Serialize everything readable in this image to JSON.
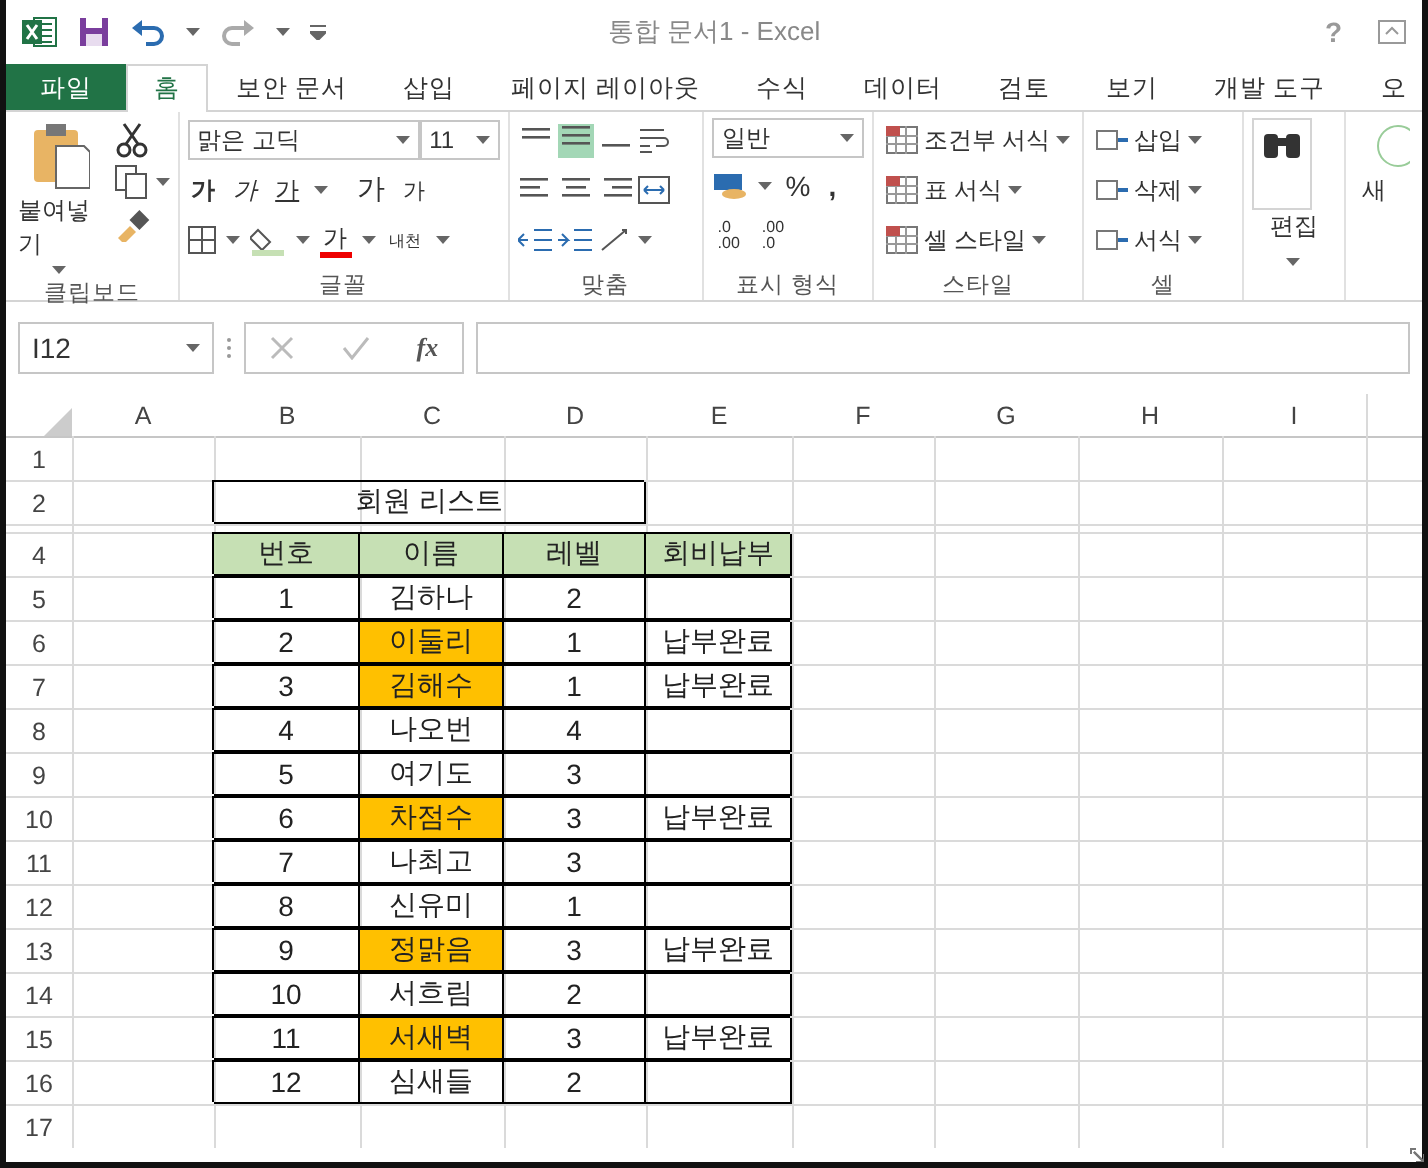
{
  "window": {
    "title": "통합 문서1 - Excel",
    "help": "?"
  },
  "tabs": [
    {
      "label": "파일",
      "kind": "file",
      "selected": false
    },
    {
      "label": "홈",
      "kind": "tab",
      "selected": true
    },
    {
      "label": "보안 문서",
      "kind": "tab",
      "selected": false
    },
    {
      "label": "삽입",
      "kind": "tab",
      "selected": false
    },
    {
      "label": "페이지 레이아웃",
      "kind": "tab",
      "selected": false
    },
    {
      "label": "수식",
      "kind": "tab",
      "selected": false
    },
    {
      "label": "데이터",
      "kind": "tab",
      "selected": false
    },
    {
      "label": "검토",
      "kind": "tab",
      "selected": false
    },
    {
      "label": "보기",
      "kind": "tab",
      "selected": false
    },
    {
      "label": "개발 도구",
      "kind": "tab",
      "selected": false
    },
    {
      "label": "오",
      "kind": "tab",
      "selected": false
    }
  ],
  "ribbon": {
    "clipboard": {
      "paste": "붙여넣기",
      "label": "클립보드"
    },
    "font": {
      "name": "맑은 고딕",
      "size": "11",
      "styles": [
        "가",
        "가",
        "가"
      ],
      "grow": "가",
      "shrink": "가",
      "color_button": "가",
      "phonetic": "내천",
      "label": "글꼴"
    },
    "alignment": {
      "label": "맞춤"
    },
    "number": {
      "format": "일반",
      "percent": "%",
      "comma": ",",
      "decimals": [
        {
          "top": ".0",
          "bottom": ".00"
        },
        {
          "top": ".00",
          "bottom": ".0"
        }
      ],
      "label": "표시 형식"
    },
    "styles": {
      "items": [
        "조건부 서식",
        "표 서식",
        "셀 스타일"
      ],
      "label": "스타일"
    },
    "cells": {
      "items": [
        "삽입",
        "삭제",
        "서식"
      ],
      "label": "셀"
    },
    "editing": {
      "label": "편집"
    },
    "extra": {
      "label": "새"
    }
  },
  "formula_bar": {
    "name_box": "I12",
    "fx": "fx"
  },
  "columns": [
    "A",
    "B",
    "C",
    "D",
    "E",
    "F",
    "G",
    "H",
    "I"
  ],
  "row_headers": [
    {
      "kind": "row",
      "label": "1"
    },
    {
      "kind": "row",
      "label": "2"
    },
    {
      "kind": "thin"
    },
    {
      "kind": "row",
      "label": "4"
    },
    {
      "kind": "row",
      "label": "5"
    },
    {
      "kind": "row",
      "label": "6"
    },
    {
      "kind": "row",
      "label": "7"
    },
    {
      "kind": "row",
      "label": "8"
    },
    {
      "kind": "row",
      "label": "9"
    },
    {
      "kind": "row",
      "label": "10"
    },
    {
      "kind": "row",
      "label": "11"
    },
    {
      "kind": "row",
      "label": "12"
    },
    {
      "kind": "row",
      "label": "13"
    },
    {
      "kind": "row",
      "label": "14"
    },
    {
      "kind": "row",
      "label": "15"
    },
    {
      "kind": "row",
      "label": "16"
    },
    {
      "kind": "row",
      "label": "17"
    }
  ],
  "sheet": {
    "title": "회원 리스트",
    "headers": [
      "번호",
      "이름",
      "레벨",
      "회비납부"
    ],
    "rows": [
      {
        "no": "1",
        "name": "김하나",
        "level": "2",
        "paid": "",
        "highlight": false
      },
      {
        "no": "2",
        "name": "이둘리",
        "level": "1",
        "paid": "납부완료",
        "highlight": true
      },
      {
        "no": "3",
        "name": "김해수",
        "level": "1",
        "paid": "납부완료",
        "highlight": true
      },
      {
        "no": "4",
        "name": "나오번",
        "level": "4",
        "paid": "",
        "highlight": false
      },
      {
        "no": "5",
        "name": "여기도",
        "level": "3",
        "paid": "",
        "highlight": false
      },
      {
        "no": "6",
        "name": "차점수",
        "level": "3",
        "paid": "납부완료",
        "highlight": true
      },
      {
        "no": "7",
        "name": "나최고",
        "level": "3",
        "paid": "",
        "highlight": false
      },
      {
        "no": "8",
        "name": "신유미",
        "level": "1",
        "paid": "",
        "highlight": false
      },
      {
        "no": "9",
        "name": "정맑음",
        "level": "3",
        "paid": "납부완료",
        "highlight": true
      },
      {
        "no": "10",
        "name": "서흐림",
        "level": "2",
        "paid": "",
        "highlight": false
      },
      {
        "no": "11",
        "name": "서새벽",
        "level": "3",
        "paid": "납부완료",
        "highlight": true
      },
      {
        "no": "12",
        "name": "심새들",
        "level": "2",
        "paid": "",
        "highlight": false
      }
    ]
  }
}
